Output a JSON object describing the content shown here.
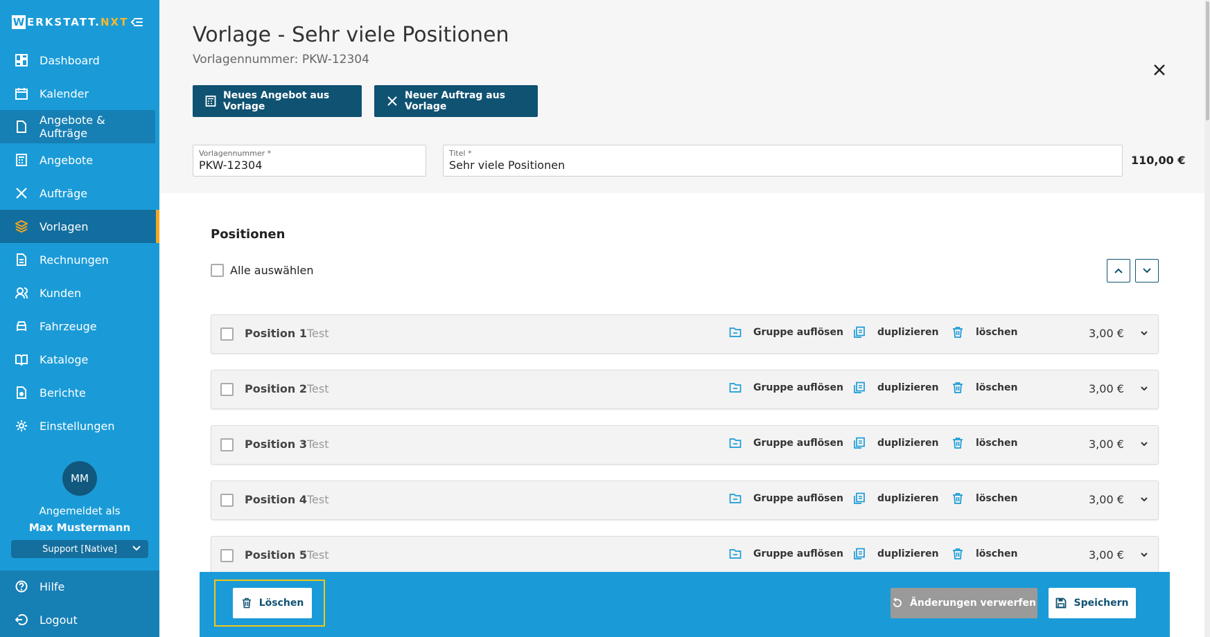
{
  "brand": {
    "letter": "W",
    "text_main": "ERKSTATT.",
    "text_accent": "NXT"
  },
  "sidebar": {
    "items": [
      {
        "label": "Dashboard",
        "icon": "dashboard-icon"
      },
      {
        "label": "Kalender",
        "icon": "calendar-icon"
      },
      {
        "label": "Angebote & Aufträge",
        "icon": "document-icon"
      },
      {
        "label": "Angebote",
        "icon": "calculator-icon"
      },
      {
        "label": "Aufträge",
        "icon": "tools-icon"
      },
      {
        "label": "Vorlagen",
        "icon": "layers-icon"
      },
      {
        "label": "Rechnungen",
        "icon": "invoice-icon"
      },
      {
        "label": "Kunden",
        "icon": "users-icon"
      },
      {
        "label": "Fahrzeuge",
        "icon": "car-icon"
      },
      {
        "label": "Kataloge",
        "icon": "book-icon"
      },
      {
        "label": "Berichte",
        "icon": "report-icon"
      },
      {
        "label": "Einstellungen",
        "icon": "gear-icon"
      }
    ],
    "active_item": "Vorlagen",
    "user": {
      "initials": "MM",
      "logged_in_as": "Angemeldet als",
      "name": "Max Mustermann",
      "role": "Support [Native]"
    },
    "bottom": [
      {
        "label": "Hilfe",
        "icon": "help-icon"
      },
      {
        "label": "Logout",
        "icon": "logout-icon"
      }
    ]
  },
  "header": {
    "title": "Vorlage - Sehr viele Positionen",
    "subtitle": "Vorlagennummer: PKW-12304",
    "buttons": {
      "new_offer": "Neues Angebot aus Vorlage",
      "new_order": "Neuer Auftrag aus Vorlage"
    },
    "fields": {
      "number_label": "Vorlagennummer *",
      "number_value": "PKW-12304",
      "title_label": "Titel *",
      "title_value": "Sehr viele Positionen"
    },
    "total": "110,00 €"
  },
  "positions": {
    "section_title": "Positionen",
    "select_all": "Alle auswählen",
    "action_labels": {
      "ungroup": "Gruppe auflösen",
      "duplicate": "duplizieren",
      "delete": "löschen"
    },
    "items": [
      {
        "name": "Position 1",
        "sub": "Test",
        "price": "3,00 €"
      },
      {
        "name": "Position 2",
        "sub": "Test",
        "price": "3,00 €"
      },
      {
        "name": "Position 3",
        "sub": "Test",
        "price": "3,00 €"
      },
      {
        "name": "Position 4",
        "sub": "Test",
        "price": "3,00 €"
      },
      {
        "name": "Position 5",
        "sub": "Test",
        "price": "3,00 €"
      }
    ]
  },
  "action_bar": {
    "delete": "Löschen",
    "discard": "Änderungen verwerfen",
    "save": "Speichern"
  },
  "colors": {
    "sidebar": "#1a9bd7",
    "dark_button": "#0f5272",
    "accent": "#f5a623",
    "focus": "#f5c518"
  }
}
